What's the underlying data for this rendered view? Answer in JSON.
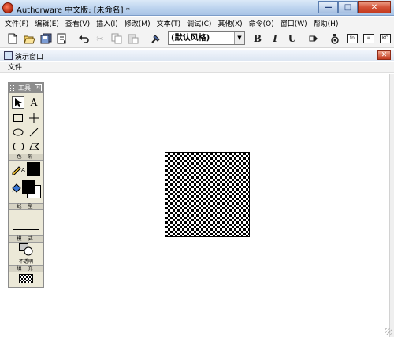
{
  "window": {
    "title": "Authorware 中文版: [未命名] *",
    "buttons": {
      "minimize": "—",
      "maximize": "□",
      "close": "✕"
    }
  },
  "menu": [
    "文件(F)",
    "编辑(E)",
    "查看(V)",
    "插入(I)",
    "修改(M)",
    "文本(T)",
    "调试(C)",
    "其他(X)",
    "命令(O)",
    "窗口(W)",
    "帮助(H)"
  ],
  "toolbar": {
    "style_value": "(默认风格)",
    "bold_label": "B",
    "italic_label": "I",
    "underline_label": "U",
    "icons": [
      "new-icon",
      "open-icon",
      "save-all-icon",
      "import-icon",
      "undo-icon",
      "cut-icon",
      "copy-icon",
      "paste-icon",
      "find-icon",
      "bold-icon",
      "italic-icon",
      "underline-icon",
      "run-icon",
      "control-panel-icon",
      "functions-icon",
      "variables-icon",
      "knowledge-objects-icon"
    ]
  },
  "presentation": {
    "title": "演示窗口",
    "close": "✕",
    "menu_file": "文件"
  },
  "tools_palette": {
    "title": "工具",
    "close": "✕",
    "section_color": "色 彩",
    "section_line": "线 型",
    "section_mode": "模 式",
    "mode_value": "不透明",
    "section_fill": "填 充",
    "pen_color": "#000000",
    "fill_foreground": "#000000",
    "fill_background": "#ffffff"
  }
}
